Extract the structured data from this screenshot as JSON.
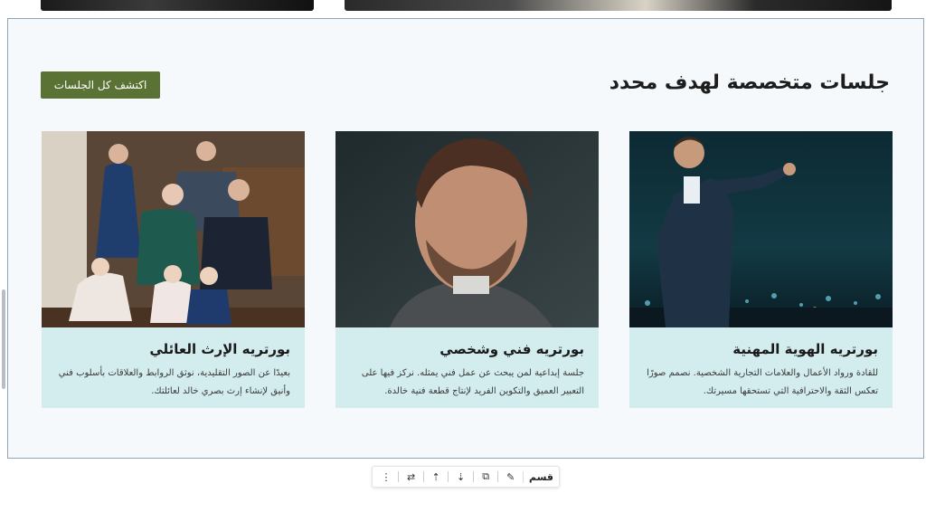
{
  "section": {
    "title": "جلسات متخصصة لهدف محدد",
    "cta_label": "اكتشف كل الجلسات"
  },
  "cards": [
    {
      "title": "بورتريه الهوية المهنية",
      "description": "للقادة ورواد الأعمال والعلامات التجارية الشخصية. نصمم صورًا تعكس الثقة والاحترافية التي تستحقها مسيرتك."
    },
    {
      "title": "بورتريه فني وشخصي",
      "description": "جلسة إبداعية لمن يبحث عن عمل فني يمثله. نركز فيها على التعبير العميق والتكوين الفريد لإنتاج قطعة فنية خالدة."
    },
    {
      "title": "بورتريه الإرث العائلي",
      "description": "بعيدًا عن الصور التقليدية، نوثق الروابط والعلاقات بأسلوب فني وأنيق لإنشاء إرث بصري خالد لعائلتك."
    }
  ],
  "toolbar": {
    "label": "قسم",
    "icons": [
      "pencil-icon",
      "copy-icon",
      "move-down-icon",
      "move-up-icon",
      "swap-icon",
      "more-icon"
    ]
  }
}
